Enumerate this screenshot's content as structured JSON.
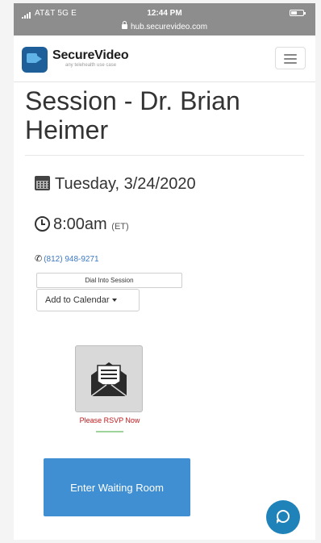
{
  "status_bar": {
    "carrier": "AT&T 5G E",
    "time": "12:44 PM",
    "url": "hub.securevideo.com"
  },
  "header": {
    "brand_name": "SecureVideo",
    "brand_tagline": "any telehealth use case",
    "logo_icon": "video-camera-icon",
    "menu_icon": "hamburger-menu-icon"
  },
  "session": {
    "title": "Session - Dr. Brian Heimer",
    "date": "Tuesday, 3/24/2020",
    "time": "8:00am",
    "time_zone": "(ET)",
    "phone": "(812) 948-9271"
  },
  "actions": {
    "dial_label": "Dial Into Session",
    "add_calendar_label": "Add to Calendar",
    "rsvp_label": "Please RSVP Now",
    "enter_waiting_room_label": "Enter Waiting Room"
  },
  "colors": {
    "primary_button": "#3f8fd2",
    "link": "#3a78c3",
    "rsvp_text": "#c2181c",
    "chat_bubble": "#1f82b8",
    "status_bar": "#8d8d8d"
  },
  "icons": [
    "calendar-icon",
    "clock-icon",
    "phone-icon",
    "envelope-icon",
    "chat-bubble-icon",
    "lock-icon",
    "battery-icon",
    "signal-icon"
  ]
}
